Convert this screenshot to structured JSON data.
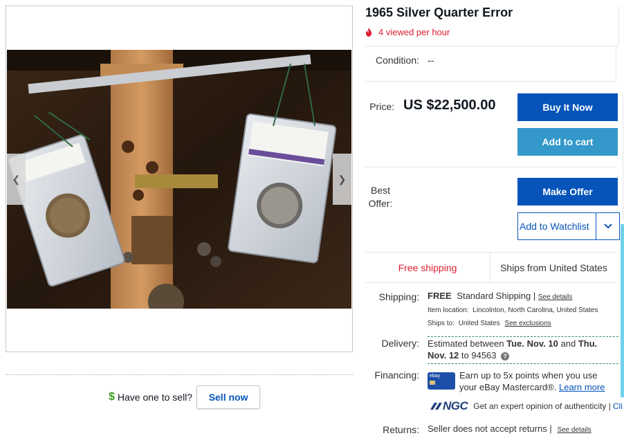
{
  "listing": {
    "title": "1965 Silver Quarter Error",
    "views_text": "4 viewed per hour",
    "condition_label": "Condition:",
    "condition_value": "--",
    "price_label": "Price:",
    "price_value": "US $22,500.00",
    "best_offer_label_1": "Best",
    "best_offer_label_2": "Offer:"
  },
  "buttons": {
    "buy_now": "Buy It Now",
    "add_to_cart": "Add to cart",
    "make_offer": "Make Offer",
    "add_to_watchlist": "Add to Watchlist"
  },
  "shipping_banner": {
    "free": "Free shipping",
    "from": "Ships from United States"
  },
  "shipping": {
    "label": "Shipping:",
    "free": "FREE",
    "method": "Standard Shipping |",
    "see_details": "See details",
    "item_location_label": "Item location:",
    "item_location": "Lincolnton, North Carolina, United States",
    "ships_to_label": "Ships to:",
    "ships_to": "United States",
    "see_exclusions": "See exclusions"
  },
  "delivery": {
    "label": "Delivery:",
    "prefix": "Estimated between",
    "start": "Tue. Nov. 10",
    "and": "and",
    "end": "Thu. Nov. 12",
    "to": "to 94563"
  },
  "financing": {
    "label": "Financing:",
    "line1": "Earn up to 5x points when you use",
    "line2": "your eBay Mastercard®.",
    "learn_more": "Learn more",
    "card_text": "ebay"
  },
  "ngc": {
    "logo": "NGC",
    "text": "Get an expert opinion of authenticity |",
    "link_fragment": "Cli"
  },
  "returns": {
    "label": "Returns:",
    "text": "Seller does not accept returns |",
    "see_details": "See details"
  },
  "sell": {
    "prompt": "Have one to sell?",
    "button": "Sell now"
  },
  "gallery": {
    "prev_icon": "chevron-left-icon",
    "next_icon": "chevron-right-icon"
  },
  "colors": {
    "primary": "#0654ba",
    "secondary": "#3498ca",
    "alert_red": "#dd1e31",
    "money_green": "#3a9b1f"
  }
}
